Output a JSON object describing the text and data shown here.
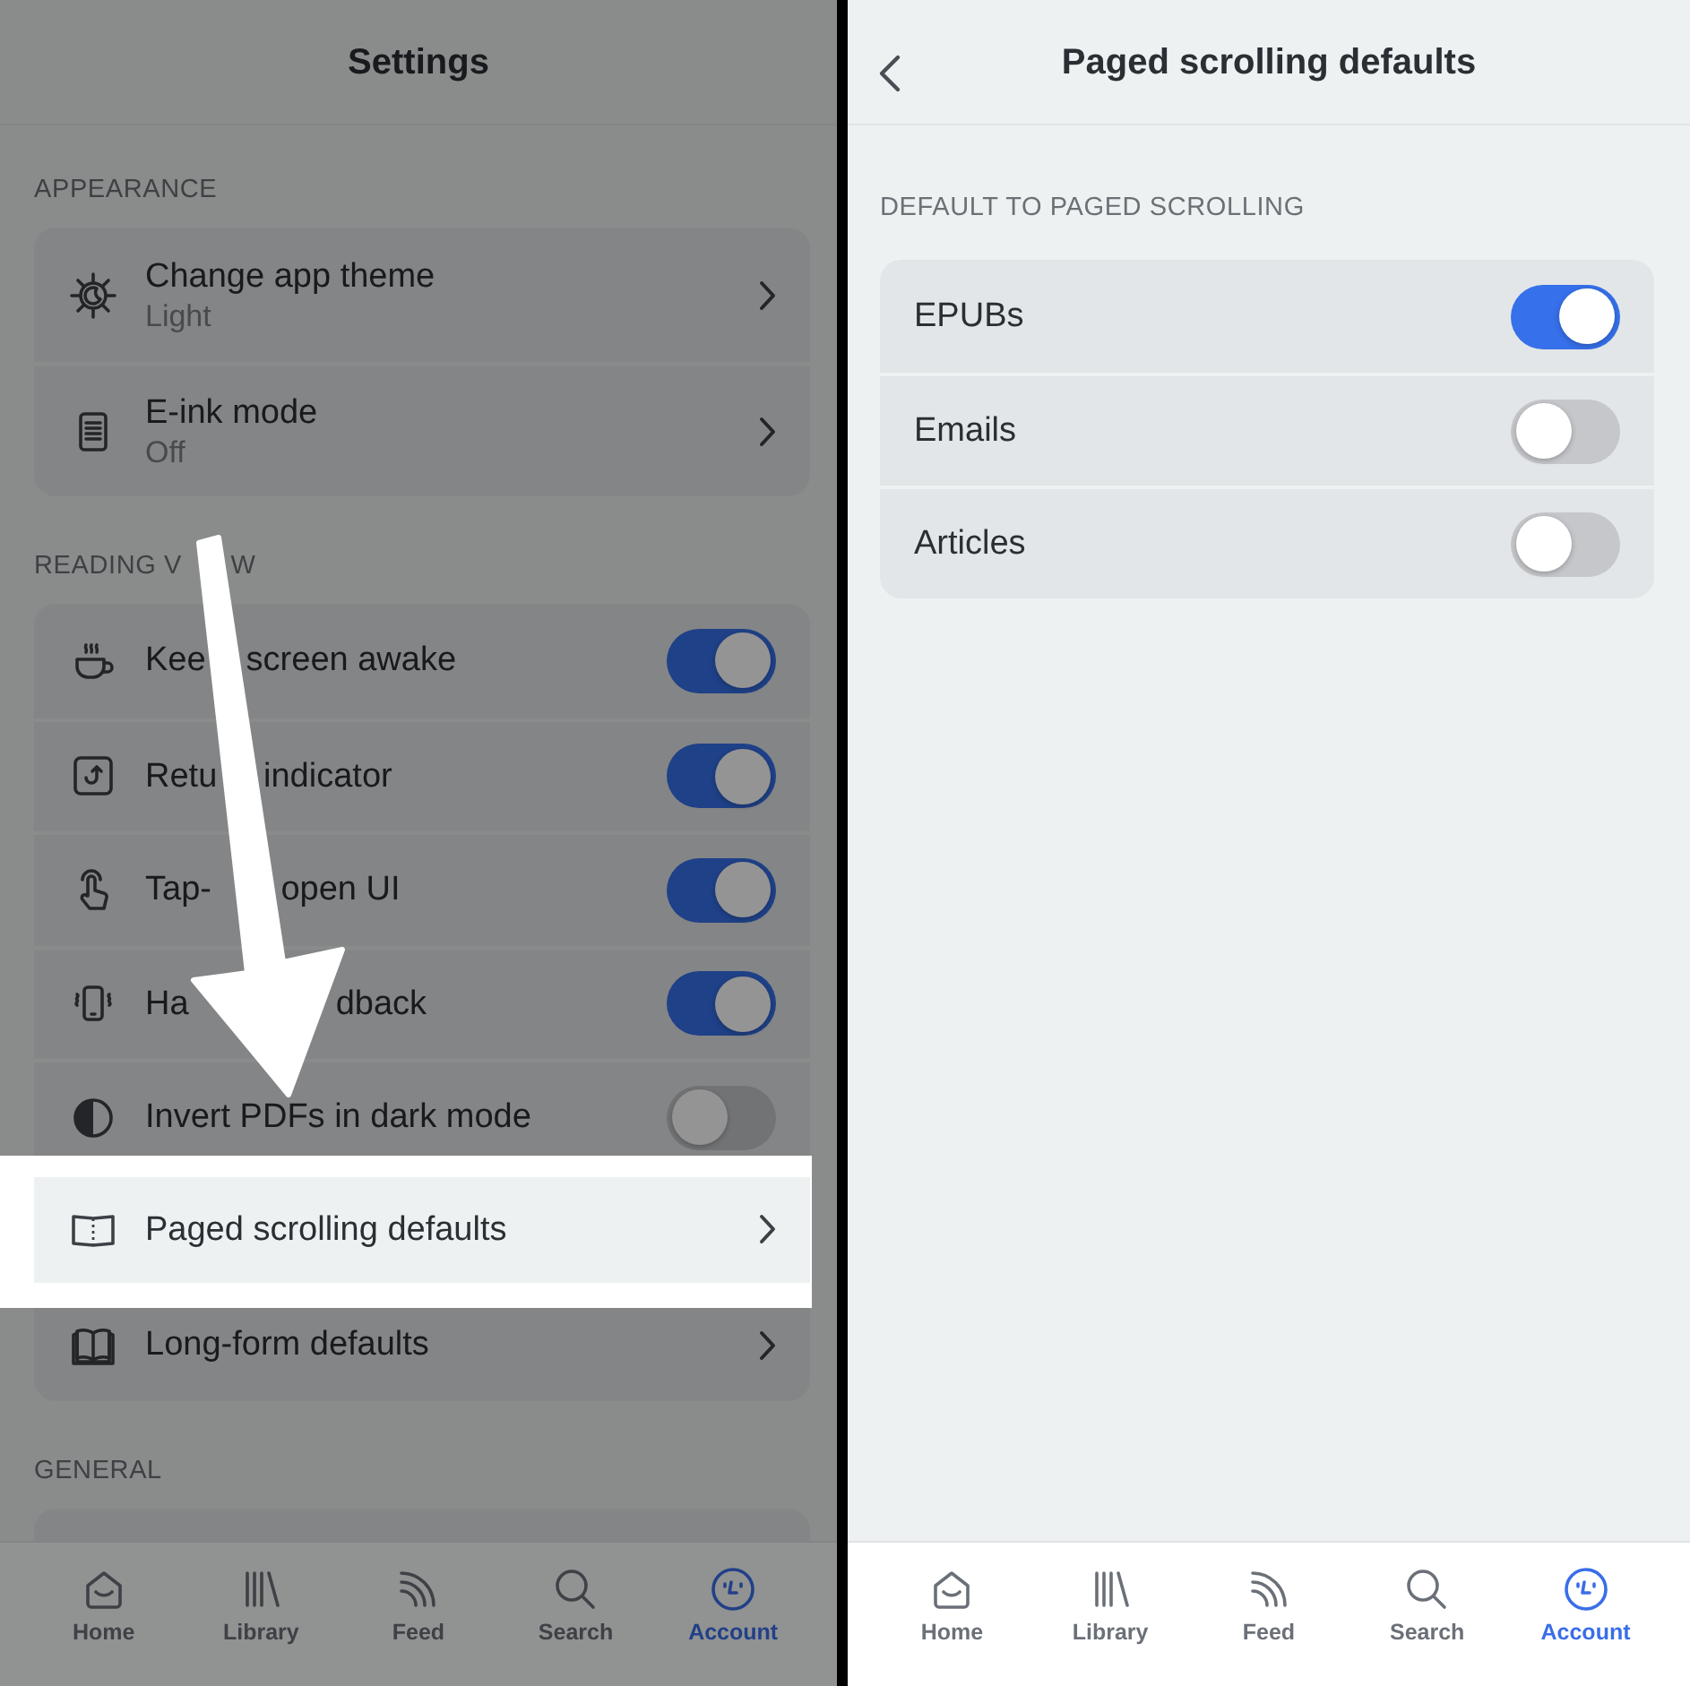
{
  "screens": [
    {
      "title": "Settings",
      "has_back": false,
      "dimmed": true,
      "sections": [
        {
          "heading": [
            "APPEARANCE"
          ],
          "rows": [
            {
              "kind": "link",
              "title": [
                "Change app theme"
              ],
              "subtitle": "Light",
              "highlighted": false
            },
            {
              "kind": "link",
              "title": [
                "E-ink mode"
              ],
              "subtitle": "Off",
              "highlighted": false
            }
          ]
        },
        {
          "heading": [
            "READING V",
            "W"
          ],
          "rows": [
            {
              "kind": "toggle",
              "title": [
                "Kee",
                "screen awake"
              ],
              "on": true,
              "highlighted": false
            },
            {
              "kind": "toggle",
              "title": [
                "Retu",
                "indicator"
              ],
              "on": true,
              "highlighted": false
            },
            {
              "kind": "toggle",
              "title": [
                "Tap-",
                "open UI"
              ],
              "on": true,
              "highlighted": false
            },
            {
              "kind": "toggle",
              "title": [
                "Ha",
                "dback"
              ],
              "on": true,
              "highlighted": false
            },
            {
              "kind": "toggle",
              "title": [
                "Invert PDFs in dark mode"
              ],
              "on": false,
              "highlighted": false
            },
            {
              "kind": "link",
              "title": [
                "Paged scrolling defaults"
              ],
              "highlighted": true
            },
            {
              "kind": "link",
              "title": [
                "Long-form defaults"
              ],
              "highlighted": false
            }
          ]
        },
        {
          "heading": [
            "GENERAL"
          ]
        }
      ],
      "tabs": [
        {
          "label": "Home",
          "selected": false
        },
        {
          "label": "Library",
          "selected": false
        },
        {
          "label": "Feed",
          "selected": false
        },
        {
          "label": "Search",
          "selected": false
        },
        {
          "label": "Account",
          "selected": true
        }
      ]
    },
    {
      "title": "Paged scrolling defaults",
      "has_back": true,
      "dimmed": false,
      "sections": [
        {
          "heading": [
            "DEFAULT TO PAGED SCROLLING"
          ],
          "rows": [
            {
              "kind": "toggle",
              "title": [
                "EPUBs"
              ],
              "on": true
            },
            {
              "kind": "toggle",
              "title": [
                "Emails"
              ],
              "on": false
            },
            {
              "kind": "toggle",
              "title": [
                "Articles"
              ],
              "on": false
            }
          ]
        }
      ],
      "tabs": [
        {
          "label": "Home",
          "selected": false
        },
        {
          "label": "Library",
          "selected": false
        },
        {
          "label": "Feed",
          "selected": false
        },
        {
          "label": "Search",
          "selected": false
        },
        {
          "label": "Account",
          "selected": true
        }
      ]
    }
  ]
}
